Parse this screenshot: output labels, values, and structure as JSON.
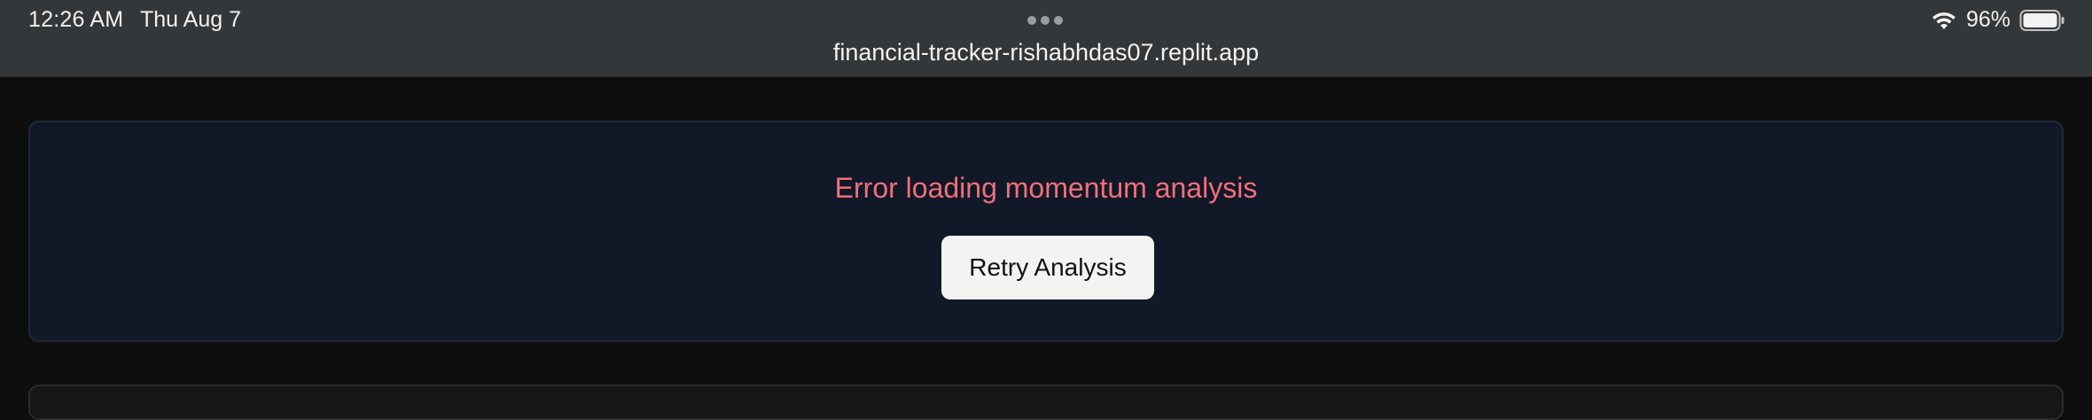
{
  "status_bar": {
    "time": "12:26 AM",
    "date": "Thu Aug 7",
    "battery": "96%",
    "wifi_icon": "wifi-icon",
    "battery_icon": "battery-icon",
    "more_icon": "more-dots-icon"
  },
  "browser": {
    "url": "financial-tracker-rishabhdas07.replit.app"
  },
  "momentum_panel": {
    "error_message": "Error loading momentum analysis",
    "retry_label": "Retry Analysis"
  },
  "colors": {
    "error": "#f0707a",
    "panel_bg": "#111827",
    "page_bg": "#0e0e0f"
  }
}
